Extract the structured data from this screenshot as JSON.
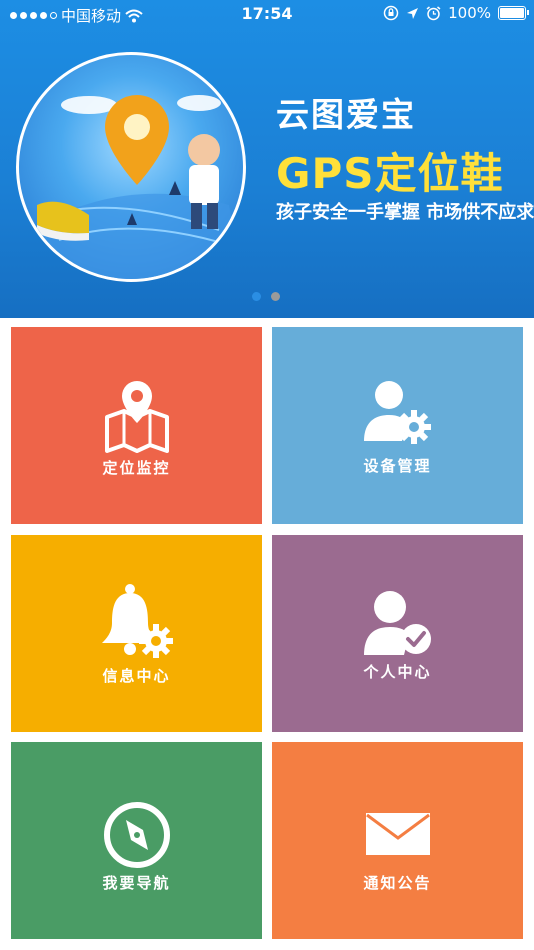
{
  "status_bar": {
    "carrier": "中国移动",
    "time": "17:54",
    "battery": "100%"
  },
  "banner": {
    "title": "云图爱宝",
    "headline": "GPS定位鞋",
    "slogan": "孩子安全一手掌握 市场供不应求",
    "active_page": 1,
    "page_count": 2
  },
  "menu": {
    "location": "定位监控",
    "device": "设备管理",
    "messages": "信息中心",
    "profile": "个人中心",
    "navigation": "我要导航",
    "notice": "通知公告"
  },
  "colors": {
    "location": "#ee6449",
    "device": "#66add9",
    "messages": "#f6ae00",
    "profile": "#9b6b90",
    "navigation": "#4a9c65",
    "notice": "#f47e42",
    "headline": "#ffe03a"
  }
}
